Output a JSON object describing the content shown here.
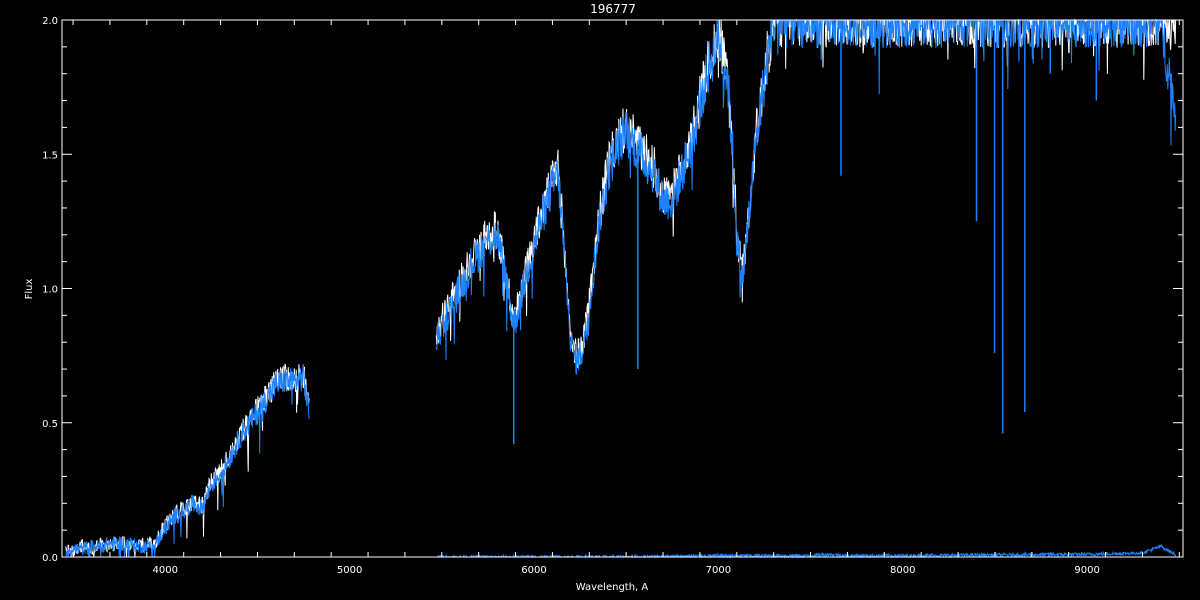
{
  "chart_data": {
    "type": "line",
    "title": "196777",
    "xlabel": "Wavelength, A",
    "ylabel": "Flux",
    "xlim": [
      3440,
      9520
    ],
    "ylim": [
      0.0,
      2.0
    ],
    "x_ticks": [
      4000,
      5000,
      6000,
      7000,
      8000,
      9000
    ],
    "y_ticks": [
      0.0,
      0.5,
      1.0,
      1.5,
      2.0
    ],
    "x_tick_labels": [
      "4000",
      "5000",
      "6000",
      "7000",
      "8000",
      "9000"
    ],
    "y_tick_labels": [
      "0.0",
      "0.5",
      "1.0",
      "1.5",
      "2.0"
    ],
    "grid": false,
    "background": "#000000",
    "axis_color": "#ffffff",
    "series": [
      {
        "color": "#ffffff",
        "segments": [
          [
            [
              3460,
              0.03
            ],
            [
              3500,
              0.02
            ],
            [
              3550,
              0.04
            ],
            [
              3600,
              0.03
            ],
            [
              3650,
              0.05
            ],
            [
              3700,
              0.04
            ],
            [
              3750,
              0.06
            ],
            [
              3800,
              0.05
            ],
            [
              3850,
              0.04
            ],
            [
              3900,
              0.05
            ],
            [
              3950,
              0.06
            ],
            [
              4000,
              0.12
            ],
            [
              4050,
              0.16
            ],
            [
              4100,
              0.18
            ],
            [
              4150,
              0.21
            ],
            [
              4200,
              0.19
            ],
            [
              4250,
              0.28
            ],
            [
              4300,
              0.32
            ],
            [
              4350,
              0.38
            ],
            [
              4400,
              0.45
            ],
            [
              4450,
              0.5
            ],
            [
              4500,
              0.55
            ],
            [
              4550,
              0.6
            ],
            [
              4600,
              0.65
            ],
            [
              4650,
              0.67
            ],
            [
              4700,
              0.66
            ],
            [
              4750,
              0.68
            ],
            [
              4780,
              0.55
            ]
          ],
          [
            [
              5470,
              0.82
            ],
            [
              5500,
              0.88
            ],
            [
              5550,
              0.95
            ],
            [
              5600,
              1.02
            ],
            [
              5650,
              1.1
            ],
            [
              5700,
              1.15
            ],
            [
              5750,
              1.2
            ],
            [
              5800,
              1.22
            ],
            [
              5850,
              1.05
            ],
            [
              5880,
              0.92
            ],
            [
              5900,
              0.9
            ],
            [
              5950,
              1.05
            ],
            [
              6000,
              1.18
            ],
            [
              6050,
              1.3
            ],
            [
              6100,
              1.4
            ],
            [
              6130,
              1.45
            ],
            [
              6150,
              1.28
            ],
            [
              6180,
              1.0
            ],
            [
              6200,
              0.82
            ],
            [
              6230,
              0.75
            ],
            [
              6260,
              0.78
            ],
            [
              6300,
              0.95
            ],
            [
              6350,
              1.25
            ],
            [
              6400,
              1.45
            ],
            [
              6450,
              1.55
            ],
            [
              6500,
              1.6
            ],
            [
              6550,
              1.55
            ],
            [
              6600,
              1.5
            ],
            [
              6650,
              1.45
            ],
            [
              6700,
              1.35
            ],
            [
              6750,
              1.35
            ],
            [
              6800,
              1.45
            ],
            [
              6850,
              1.55
            ],
            [
              6900,
              1.7
            ],
            [
              6950,
              1.85
            ],
            [
              7000,
              1.95
            ],
            [
              7050,
              1.8
            ],
            [
              7080,
              1.5
            ],
            [
              7100,
              1.2
            ],
            [
              7130,
              1.05
            ],
            [
              7160,
              1.25
            ],
            [
              7200,
              1.55
            ],
            [
              7250,
              1.8
            ],
            [
              7300,
              2.0
            ],
            [
              7400,
              2.0
            ],
            [
              7600,
              2.0
            ],
            [
              7800,
              2.0
            ],
            [
              8000,
              2.0
            ],
            [
              8200,
              2.0
            ],
            [
              8400,
              2.0
            ],
            [
              8600,
              2.0
            ],
            [
              8800,
              2.0
            ],
            [
              9000,
              2.0
            ],
            [
              9200,
              2.0
            ],
            [
              9400,
              2.0
            ],
            [
              9480,
              2.0
            ]
          ]
        ]
      },
      {
        "color": "#1e82ff",
        "segments": [
          [
            [
              3460,
              0.02
            ],
            [
              3500,
              0.03
            ],
            [
              3550,
              0.03
            ],
            [
              3600,
              0.04
            ],
            [
              3650,
              0.04
            ],
            [
              3700,
              0.05
            ],
            [
              3750,
              0.05
            ],
            [
              3800,
              0.05
            ],
            [
              3850,
              0.04
            ],
            [
              3900,
              0.04
            ],
            [
              3950,
              0.05
            ],
            [
              4000,
              0.11
            ],
            [
              4050,
              0.15
            ],
            [
              4100,
              0.17
            ],
            [
              4150,
              0.2
            ],
            [
              4200,
              0.18
            ],
            [
              4250,
              0.27
            ],
            [
              4300,
              0.31
            ],
            [
              4350,
              0.37
            ],
            [
              4400,
              0.44
            ],
            [
              4450,
              0.49
            ],
            [
              4500,
              0.54
            ],
            [
              4550,
              0.59
            ],
            [
              4600,
              0.64
            ],
            [
              4650,
              0.66
            ],
            [
              4700,
              0.65
            ],
            [
              4750,
              0.67
            ],
            [
              4780,
              0.54
            ]
          ],
          [
            [
              5470,
              0.8
            ],
            [
              5500,
              0.86
            ],
            [
              5550,
              0.93
            ],
            [
              5600,
              1.0
            ],
            [
              5650,
              1.08
            ],
            [
              5700,
              1.13
            ],
            [
              5750,
              1.18
            ],
            [
              5800,
              1.2
            ],
            [
              5850,
              1.03
            ],
            [
              5880,
              0.9
            ],
            [
              5900,
              0.88
            ],
            [
              5950,
              1.03
            ],
            [
              6000,
              1.16
            ],
            [
              6050,
              1.28
            ],
            [
              6100,
              1.38
            ],
            [
              6130,
              1.43
            ],
            [
              6150,
              1.26
            ],
            [
              6180,
              0.98
            ],
            [
              6200,
              0.8
            ],
            [
              6230,
              0.73
            ],
            [
              6260,
              0.76
            ],
            [
              6300,
              0.93
            ],
            [
              6350,
              1.23
            ],
            [
              6400,
              1.43
            ],
            [
              6450,
              1.53
            ],
            [
              6500,
              1.58
            ],
            [
              6550,
              1.53
            ],
            [
              6600,
              1.48
            ],
            [
              6650,
              1.43
            ],
            [
              6700,
              1.33
            ],
            [
              6750,
              1.33
            ],
            [
              6800,
              1.43
            ],
            [
              6850,
              1.53
            ],
            [
              6900,
              1.68
            ],
            [
              6950,
              1.83
            ],
            [
              7000,
              1.93
            ],
            [
              7050,
              1.78
            ],
            [
              7080,
              1.48
            ],
            [
              7100,
              1.18
            ],
            [
              7130,
              1.03
            ],
            [
              7160,
              1.23
            ],
            [
              7200,
              1.53
            ],
            [
              7250,
              1.78
            ],
            [
              7300,
              2.0
            ],
            [
              7400,
              2.0
            ],
            [
              7600,
              2.0
            ],
            [
              7800,
              2.0
            ],
            [
              8000,
              2.0
            ],
            [
              8200,
              2.0
            ],
            [
              8400,
              2.0
            ],
            [
              8600,
              2.0
            ],
            [
              8800,
              2.0
            ],
            [
              9000,
              2.0
            ],
            [
              9200,
              2.0
            ],
            [
              9400,
              2.0
            ],
            [
              9480,
              1.65
            ]
          ],
          [
            [
              5470,
              0.0
            ],
            [
              6000,
              0.0
            ],
            [
              6500,
              0.0
            ],
            [
              7000,
              0.005
            ],
            [
              7500,
              0.005
            ],
            [
              7600,
              0.01
            ],
            [
              7700,
              0.005
            ],
            [
              8000,
              0.005
            ],
            [
              8500,
              0.008
            ],
            [
              9000,
              0.01
            ],
            [
              9300,
              0.015
            ],
            [
              9400,
              0.04
            ],
            [
              9450,
              0.02
            ],
            [
              9480,
              0.01
            ]
          ]
        ],
        "spikes": [
          {
            "x": 5890,
            "y": 0.42
          },
          {
            "x": 6563,
            "y": 0.7
          },
          {
            "x": 7665,
            "y": 1.42
          },
          {
            "x": 8400,
            "y": 1.25
          },
          {
            "x": 8498,
            "y": 0.76
          },
          {
            "x": 8542,
            "y": 0.46
          },
          {
            "x": 8662,
            "y": 0.54
          },
          {
            "x": 8800,
            "y": 1.8
          },
          {
            "x": 9050,
            "y": 1.7
          }
        ]
      }
    ]
  }
}
